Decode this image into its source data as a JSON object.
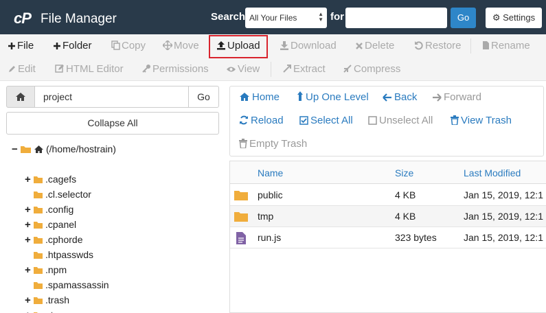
{
  "header": {
    "logo": "cP",
    "title": "File Manager",
    "search_label": "Search",
    "search_scope": "All Your Files",
    "for_label": "for",
    "search_value": "",
    "go_label": "Go",
    "settings_label": "Settings"
  },
  "toolbar": {
    "file": "File",
    "folder": "Folder",
    "copy": "Copy",
    "move": "Move",
    "upload": "Upload",
    "download": "Download",
    "delete": "Delete",
    "restore": "Restore",
    "rename": "Rename",
    "edit": "Edit",
    "html_editor": "HTML Editor",
    "permissions": "Permissions",
    "view": "View",
    "extract": "Extract",
    "compress": "Compress"
  },
  "left": {
    "path": "project",
    "go_label": "Go",
    "collapse_label": "Collapse All",
    "root": "(/home/hostrain)",
    "tree": [
      {
        "name": ".cagefs",
        "expandable": true
      },
      {
        "name": ".cl.selector",
        "expandable": false
      },
      {
        "name": ".config",
        "expandable": true
      },
      {
        "name": ".cpanel",
        "expandable": true
      },
      {
        "name": ".cphorde",
        "expandable": true
      },
      {
        "name": ".htpasswds",
        "expandable": false
      },
      {
        "name": ".npm",
        "expandable": true
      },
      {
        "name": ".spamassassin",
        "expandable": false
      },
      {
        "name": ".trash",
        "expandable": true
      },
      {
        "name": "etc",
        "expandable": true
      }
    ]
  },
  "nav": {
    "home": "Home",
    "up": "Up One Level",
    "back": "Back",
    "forward": "Forward",
    "reload": "Reload",
    "select_all": "Select All",
    "unselect_all": "Unselect All",
    "view_trash": "View Trash",
    "empty_trash": "Empty Trash"
  },
  "table": {
    "columns": [
      "Name",
      "Size",
      "Last Modified"
    ],
    "rows": [
      {
        "name": "public",
        "size": "4 KB",
        "modified": "Jan 15, 2019, 12:1",
        "type": "folder"
      },
      {
        "name": "tmp",
        "size": "4 KB",
        "modified": "Jan 15, 2019, 12:1",
        "type": "folder"
      },
      {
        "name": "run.js",
        "size": "323 bytes",
        "modified": "Jan 15, 2019, 12:1",
        "type": "file"
      }
    ]
  },
  "colors": {
    "header_bg": "#293a4a",
    "accent": "#2a7bbf",
    "highlight": "#d9232d",
    "folder": "#f0ad3c",
    "file_icon": "#8062a5"
  }
}
